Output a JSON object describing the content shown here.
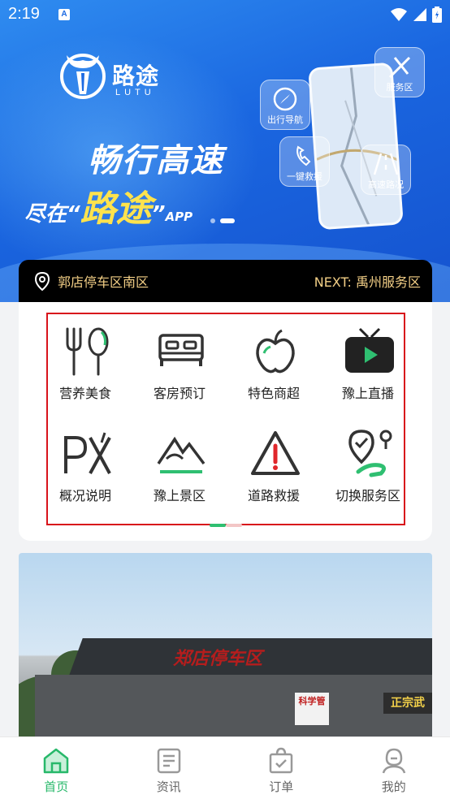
{
  "status_bar": {
    "time": "2:19",
    "notif_icon_letter": "A"
  },
  "banner": {
    "logo_text": "路途",
    "logo_sub": "LUTU",
    "slogan_line1": "畅行高速",
    "slogan_prefix": "尽在",
    "slogan_brand": "路途",
    "slogan_suffix": "APP",
    "tiles": [
      "服务区",
      "出行导航",
      "一键救援",
      "高速路况"
    ],
    "carousel": {
      "count": 2,
      "active_index": 1
    }
  },
  "location_bar": {
    "current": "郭店停车区南区",
    "next_label": "NEXT:",
    "next_name": "禹州服务区"
  },
  "services": [
    {
      "label": "营养美食",
      "icon": "fork-spoon-icon"
    },
    {
      "label": "客房预订",
      "icon": "bed-icon"
    },
    {
      "label": "特色商超",
      "icon": "apple-icon"
    },
    {
      "label": "豫上直播",
      "icon": "tv-play-icon"
    },
    {
      "label": "概况说明",
      "icon": "px-overview-icon"
    },
    {
      "label": "豫上景区",
      "icon": "mountain-icon"
    },
    {
      "label": "道路救援",
      "icon": "warning-triangle-icon"
    },
    {
      "label": "切换服务区",
      "icon": "route-pin-icon"
    }
  ],
  "photo": {
    "roof_sign": "郑店停车区",
    "shop_sign": "正宗武",
    "side_sign": "科学管"
  },
  "tabs": [
    {
      "label": "首页",
      "icon": "home-icon",
      "active": true
    },
    {
      "label": "资讯",
      "icon": "news-icon",
      "active": false
    },
    {
      "label": "订单",
      "icon": "order-bag-icon",
      "active": false
    },
    {
      "label": "我的",
      "icon": "profile-icon",
      "active": false
    }
  ],
  "colors": {
    "accent": "#27b86a",
    "location_text": "#f3cf86",
    "highlight_frame": "#d8131b"
  }
}
